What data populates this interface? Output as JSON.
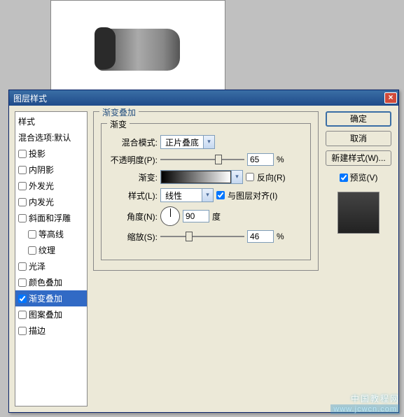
{
  "dialog": {
    "title": "图层样式",
    "close": "×"
  },
  "style_list": {
    "header1": "样式",
    "header2": "混合选项:默认",
    "items": [
      {
        "label": "投影",
        "checked": false
      },
      {
        "label": "内阴影",
        "checked": false
      },
      {
        "label": "外发光",
        "checked": false
      },
      {
        "label": "内发光",
        "checked": false
      },
      {
        "label": "斜面和浮雕",
        "checked": false
      },
      {
        "label": "等高线",
        "checked": false,
        "sub": true
      },
      {
        "label": "纹理",
        "checked": false,
        "sub": true
      },
      {
        "label": "光泽",
        "checked": false
      },
      {
        "label": "颜色叠加",
        "checked": false
      },
      {
        "label": "渐变叠加",
        "checked": true,
        "active": true
      },
      {
        "label": "图案叠加",
        "checked": false
      },
      {
        "label": "描边",
        "checked": false
      }
    ]
  },
  "panel": {
    "group_title": "渐变叠加",
    "inner_title": "渐变",
    "blend_mode_label": "混合模式:",
    "blend_mode_value": "正片叠底",
    "opacity_label": "不透明度(P):",
    "opacity_value": "65",
    "percent": "%",
    "gradient_label": "渐变:",
    "reverse_label": "反向(R)",
    "style_label": "样式(L):",
    "style_value": "线性",
    "align_label": "与图层对齐(I)",
    "angle_label": "角度(N):",
    "angle_value": "90",
    "degree": "度",
    "scale_label": "缩放(S):",
    "scale_value": "46"
  },
  "buttons": {
    "ok": "确定",
    "cancel": "取消",
    "new_style": "新建样式(W)...",
    "preview": "预览(V)"
  },
  "watermark": {
    "line1": "中国教程网",
    "line2": "www.jcwcn.com"
  }
}
